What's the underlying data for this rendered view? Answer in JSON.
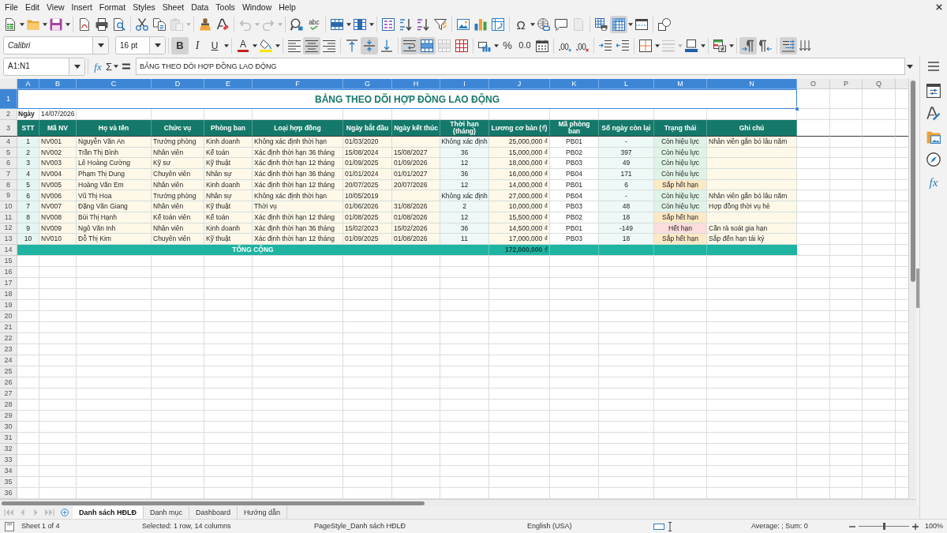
{
  "menu_bar": [
    "File",
    "Edit",
    "View",
    "Insert",
    "Format",
    "Styles",
    "Sheet",
    "Data",
    "Tools",
    "Window",
    "Help"
  ],
  "standard_toolbar": {
    "paste": {
      "disabled": true
    },
    "undo": {
      "disabled": true
    },
    "redo": {
      "disabled": true
    },
    "spelling_glyph": "abc",
    "special_character_glyph": "Ω",
    "header_footer": {
      "disabled": true
    },
    "freeze_rows_columns": {
      "on": true
    }
  },
  "formatting_toolbar": {
    "font_name": "Calibri",
    "font_size": "16 pt",
    "bold": {
      "glyph": "B",
      "on": true
    },
    "italic": {
      "glyph": "I",
      "on": false
    },
    "underline": {
      "glyph": "U",
      "on": false
    },
    "font_color_glyph": "A",
    "align_left": {
      "on": false
    },
    "align_center": {
      "on": true
    },
    "align_right": {
      "on": false
    },
    "align_top": {
      "on": false
    },
    "align_middle": {
      "on": true
    },
    "align_bottom": {
      "on": false
    },
    "wrap_text": {
      "on": true
    },
    "merge_and_center": {
      "on": true
    },
    "merge_cells": {
      "disabled": true
    },
    "percent_glyph": "%",
    "number_glyph": "0.0",
    "border_style": {
      "disabled": true
    },
    "paragraph_left_to_right": {
      "on": true
    },
    "paragraph_right_to_left": {
      "on": false
    },
    "text_horizontal": {
      "on": true
    },
    "text_vertical": {
      "on": false
    }
  },
  "formula_bar": {
    "name_box": "A1:N1",
    "function_wizard_glyph": "fx",
    "sum_glyph": "Σ",
    "content": "BẢNG THEO DÕI HỢP ĐỒNG LAO ĐỘNG"
  },
  "sheet": {
    "column_headers": [
      {
        "label": "A",
        "selected": true
      },
      {
        "label": "B",
        "selected": true
      },
      {
        "label": "C",
        "selected": true
      },
      {
        "label": "D",
        "selected": true
      },
      {
        "label": "E",
        "selected": true
      },
      {
        "label": "F",
        "selected": true
      },
      {
        "label": "G",
        "selected": true
      },
      {
        "label": "H",
        "selected": true
      },
      {
        "label": "I",
        "selected": true
      },
      {
        "label": "J",
        "selected": true
      },
      {
        "label": "K",
        "selected": true
      },
      {
        "label": "L",
        "selected": true
      },
      {
        "label": "M",
        "selected": true
      },
      {
        "label": "N",
        "selected": true
      },
      {
        "label": "O",
        "selected": false
      },
      {
        "label": "P",
        "selected": false
      },
      {
        "label": "Q",
        "selected": false
      }
    ],
    "row_headers": [
      {
        "label": "1",
        "selected": true
      },
      {
        "label": "2",
        "selected": false
      },
      {
        "label": "3",
        "selected": false
      },
      {
        "label": "4",
        "selected": false
      },
      {
        "label": "5",
        "selected": false
      },
      {
        "label": "6",
        "selected": false
      },
      {
        "label": "7",
        "selected": false
      },
      {
        "label": "8",
        "selected": false
      },
      {
        "label": "9",
        "selected": false
      },
      {
        "label": "10",
        "selected": false
      },
      {
        "label": "11",
        "selected": false
      },
      {
        "label": "12",
        "selected": false
      },
      {
        "label": "13",
        "selected": false
      },
      {
        "label": "14",
        "selected": false
      },
      {
        "label": "15",
        "selected": false
      },
      {
        "label": "16",
        "selected": false
      },
      {
        "label": "17",
        "selected": false
      },
      {
        "label": "18",
        "selected": false
      },
      {
        "label": "19",
        "selected": false
      },
      {
        "label": "20",
        "selected": false
      },
      {
        "label": "21",
        "selected": false
      },
      {
        "label": "22",
        "selected": false
      },
      {
        "label": "23",
        "selected": false
      },
      {
        "label": "24",
        "selected": false
      },
      {
        "label": "25",
        "selected": false
      },
      {
        "label": "26",
        "selected": false
      },
      {
        "label": "27",
        "selected": false
      },
      {
        "label": "28",
        "selected": false
      },
      {
        "label": "29",
        "selected": false
      },
      {
        "label": "30",
        "selected": false
      },
      {
        "label": "31",
        "selected": false
      },
      {
        "label": "32",
        "selected": false
      },
      {
        "label": "33",
        "selected": false
      },
      {
        "label": "34",
        "selected": false
      },
      {
        "label": "35",
        "selected": false
      },
      {
        "label": "36",
        "selected": false
      }
    ],
    "title": "BẢNG THEO DÕI HỢP ĐỒNG LAO ĐỘNG",
    "date_label": "Ngày",
    "date_value": "14/07/2026",
    "table": {
      "headers": [
        "STT",
        "Mã NV",
        "Họ và tên",
        "Chức vụ",
        "Phòng ban",
        "Loại hợp đồng",
        "Ngày bắt đầu",
        "Ngày kết thúc",
        "Thời hạn (tháng)",
        "Lương cơ bản (₫)",
        "Mã phòng ban",
        "Số ngày còn lại",
        "Trạng thái",
        "Ghi chú"
      ],
      "rows": [
        {
          "stt": "1",
          "employee_id": "NV001",
          "full_name": "Nguyễn Văn An",
          "position": "Trưởng phòng",
          "department": "Kinh doanh",
          "contract_type": "Không xác định thời hạn",
          "start_date": "01/03/2020",
          "term_months": "Không xác định",
          "base_salary": "25,000,000 ₫",
          "department_code": "PB01",
          "days_remaining": "-",
          "status": {
            "text": "Còn hiệu lực",
            "color": "#dff3e7"
          },
          "note": "Nhân viên gắn bó lâu năm"
        },
        {
          "stt": "2",
          "employee_id": "NV002",
          "full_name": "Trần Thị Bình",
          "position": "Nhân viên",
          "department": "Kế toán",
          "contract_type": "Xác định thời hạn 36 tháng",
          "start_date": "15/08/2024",
          "end_date": "15/08/2027",
          "term_months": "36",
          "base_salary": "15,000,000 ₫",
          "department_code": "PB02",
          "days_remaining": "397",
          "status": {
            "text": "Còn hiệu lực",
            "color": "#dff3e7"
          }
        },
        {
          "stt": "3",
          "employee_id": "NV003",
          "full_name": "Lê Hoàng Cường",
          "position": "Kỹ sư",
          "department": "Kỹ thuật",
          "contract_type": "Xác định thời hạn 12 tháng",
          "start_date": "01/09/2025",
          "end_date": "01/09/2026",
          "term_months": "12",
          "base_salary": "18,000,000 ₫",
          "department_code": "PB03",
          "days_remaining": "49",
          "status": {
            "text": "Còn hiệu lực",
            "color": "#dff3e7"
          }
        },
        {
          "stt": "4",
          "employee_id": "NV004",
          "full_name": "Phạm Thị Dung",
          "position": "Chuyên viên",
          "department": "Nhân sự",
          "contract_type": "Xác định thời hạn 36 tháng",
          "start_date": "01/01/2024",
          "end_date": "01/01/2027",
          "term_months": "36",
          "base_salary": "16,000,000 ₫",
          "department_code": "PB04",
          "days_remaining": "171",
          "status": {
            "text": "Còn hiệu lực",
            "color": "#dff3e7"
          }
        },
        {
          "stt": "5",
          "employee_id": "NV005",
          "full_name": "Hoàng Văn Em",
          "position": "Nhân viên",
          "department": "Kinh doanh",
          "contract_type": "Xác định thời hạn 12 tháng",
          "start_date": "20/07/2025",
          "end_date": "20/07/2026",
          "term_months": "12",
          "base_salary": "14,000,000 ₫",
          "department_code": "PB01",
          "days_remaining": "6",
          "status": {
            "text": "Sắp hết hạn",
            "color": "#fde9c6"
          }
        },
        {
          "stt": "6",
          "employee_id": "NV006",
          "full_name": "Vũ Thị Hoa",
          "position": "Trưởng phòng",
          "department": "Nhân sự",
          "contract_type": "Không xác định thời hạn",
          "start_date": "10/05/2019",
          "term_months": "Không xác định",
          "base_salary": "27,000,000 ₫",
          "department_code": "PB04",
          "days_remaining": "-",
          "status": {
            "text": "Còn hiệu lực",
            "color": "#dff3e7"
          },
          "note": "Nhân viên gắn bó lâu năm"
        },
        {
          "stt": "7",
          "employee_id": "NV007",
          "full_name": "Đặng Văn Giang",
          "position": "Nhân viên",
          "department": "Kỹ thuật",
          "contract_type": "Thời vụ",
          "start_date": "01/06/2026",
          "end_date": "31/08/2026",
          "term_months": "2",
          "base_salary": "10,000,000 ₫",
          "department_code": "PB03",
          "days_remaining": "48",
          "status": {
            "text": "Còn hiệu lực",
            "color": "#dff3e7"
          },
          "note": "Hợp đồng thời vụ hè"
        },
        {
          "stt": "8",
          "employee_id": "NV008",
          "full_name": "Bùi Thị Hạnh",
          "position": "Kế toán viên",
          "department": "Kế toán",
          "contract_type": "Xác định thời hạn 12 tháng",
          "start_date": "01/08/2025",
          "end_date": "01/08/2026",
          "term_months": "12",
          "base_salary": "15,500,000 ₫",
          "department_code": "PB02",
          "days_remaining": "18",
          "status": {
            "text": "Sắp hết hạn",
            "color": "#fde9c6"
          }
        },
        {
          "stt": "9",
          "employee_id": "NV009",
          "full_name": "Ngô Văn Inh",
          "position": "Nhân viên",
          "department": "Kinh doanh",
          "contract_type": "Xác định thời hạn 36 tháng",
          "start_date": "15/02/2023",
          "end_date": "15/02/2026",
          "term_months": "36",
          "base_salary": "14,500,000 ₫",
          "department_code": "PB01",
          "days_remaining": "-149",
          "status": {
            "text": "Hết hạn",
            "color": "#fcdcdd"
          },
          "note": "Cần rà soát gia hạn"
        },
        {
          "stt": "10",
          "employee_id": "NV010",
          "full_name": "Đỗ Thị Kim",
          "position": "Chuyên viên",
          "department": "Kỹ thuật",
          "contract_type": "Xác định thời hạn 12 tháng",
          "start_date": "01/09/2025",
          "end_date": "01/08/2026",
          "term_months": "11",
          "base_salary": "17,000,000 ₫",
          "department_code": "PB03",
          "days_remaining": "18",
          "status": {
            "text": "Sắp hết hạn",
            "color": "#fde9c6"
          },
          "note": "Sắp đến hạn tái ký"
        }
      ],
      "total": {
        "label": "TỔNG CỘNG",
        "value": "172,000,000 ₫"
      }
    }
  },
  "sheet_tabs": [
    {
      "label": "Danh sách HĐLĐ",
      "selected": true
    },
    {
      "label": "Danh mục",
      "selected": false
    },
    {
      "label": "Dashboard",
      "selected": false
    },
    {
      "label": "Hướng dẫn",
      "selected": false
    }
  ],
  "sidebar": {
    "functions_glyph": "fx"
  },
  "status_bar": {
    "sheet_position": "Sheet 1 of 4",
    "selection": "Selected: 1 row, 14 columns",
    "page_style": "PageStyle_Danh sách HĐLĐ",
    "language": "English (USA)",
    "summary": "Average: ; Sum: 0",
    "zoom_slider": {
      "level": 0.5
    },
    "zoom": "100%"
  }
}
